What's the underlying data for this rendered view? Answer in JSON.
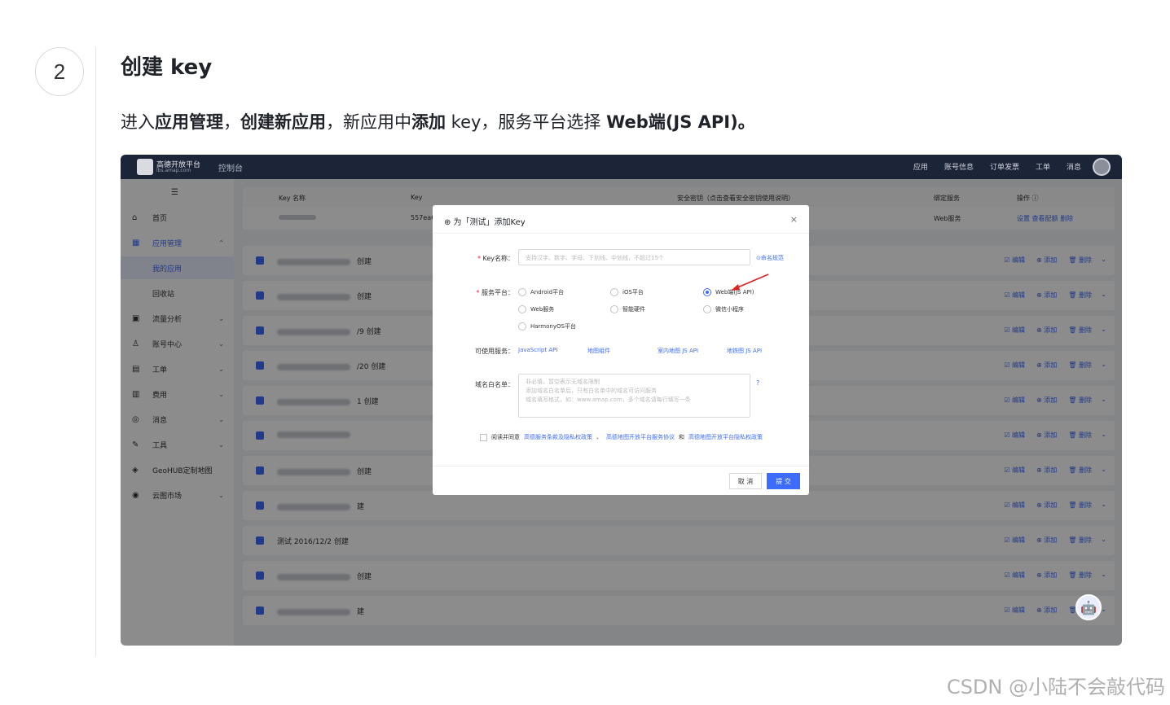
{
  "step": {
    "number": "2",
    "title": "创建 key",
    "desc": {
      "p1": "进入",
      "b1": "应用管理",
      "p2": "，",
      "b2": "创建新应用",
      "p3": "，新应用中",
      "b3": "添加",
      "p4": " key，服务平台选择 ",
      "b4": "Web端(JS API)。"
    }
  },
  "console": {
    "logo_text": "高德开放平台",
    "logo_sub": "lbs.amap.com",
    "title": "控制台",
    "nav": [
      "应用",
      "账号信息",
      "订单发票",
      "工单",
      "消息"
    ],
    "sidebar": [
      {
        "icon": "☰",
        "label": "",
        "chev": ""
      },
      {
        "icon": "⌂",
        "label": "首页",
        "chev": ""
      },
      {
        "icon": "▦",
        "label": "应用管理",
        "chev": "⌃"
      },
      {
        "icon": "",
        "label": "我的应用",
        "chev": ""
      },
      {
        "icon": "",
        "label": "回收站",
        "chev": ""
      },
      {
        "icon": "▣",
        "label": "流量分析",
        "chev": "⌄"
      },
      {
        "icon": "♙",
        "label": "账号中心",
        "chev": "⌄"
      },
      {
        "icon": "▤",
        "label": "工单",
        "chev": "⌄"
      },
      {
        "icon": "▥",
        "label": "费用",
        "chev": "⌄"
      },
      {
        "icon": "◎",
        "label": "消息",
        "chev": "⌄"
      },
      {
        "icon": "✎",
        "label": "工具",
        "chev": "⌄"
      },
      {
        "icon": "◈",
        "label": "GeoHUB定制地图",
        "chev": ""
      },
      {
        "icon": "◉",
        "label": "云图市场",
        "chev": "⌄"
      }
    ],
    "table_head": {
      "key_name": "Key 名称",
      "key": "Key",
      "secret": "安全密钥（点击查看安全密钥使用说明）",
      "service": "绑定服务",
      "ops": "操作 ⓘ"
    },
    "first_row": {
      "key": "557ea6",
      "service": "Web服务",
      "ops": "设置  查看配额  删除"
    },
    "apps": [
      {
        "suffix": "创建"
      },
      {
        "suffix": "创建"
      },
      {
        "suffix": "/9 创建"
      },
      {
        "suffix": "/20 创建"
      },
      {
        "suffix": "1 创建"
      },
      {
        "suffix": ""
      },
      {
        "suffix": "创建"
      },
      {
        "suffix": "建"
      },
      {
        "suffix": "测试  2016/12/2 创建"
      },
      {
        "suffix": "创建"
      },
      {
        "suffix": "建"
      }
    ],
    "card_actions": [
      "☑ 编辑",
      "⊕ 添加",
      "🗑 删除"
    ],
    "card_chev": "⌄"
  },
  "modal": {
    "title": "⊕ 为「测试」添加Key",
    "close": "×",
    "key_name_label": "Key名称：",
    "key_name_placeholder": "支持汉字、数字、字母、下划线、中划线，不超过15个",
    "naming_link": "⊙命名规范",
    "platform_label": "服务平台：",
    "platforms": [
      "Android平台",
      "iOS平台",
      "Web端(JS API)",
      "Web服务",
      "智能硬件",
      "微信小程序",
      "HarmonyOS平台"
    ],
    "available_label": "可使用服务：",
    "available": [
      "JavaScript API",
      "地图组件",
      "室内地图 JS API",
      "地铁图 JS API"
    ],
    "domain_label": "域名白名单：",
    "domain_placeholder": [
      "非必填，暂空表示无域名限制",
      "添加域名白名单后，只有白名单中的域名可访问服务",
      "域名填写格式，如：www.amap.com，多个域名请每行填写一条"
    ],
    "agree_text": "阅读并同意",
    "agree_links": [
      "高德服务条款及隐私权政策",
      "高德地图开放平台服务协议",
      "高德地图开放平台隐私权政策"
    ],
    "agree_sep1": "、",
    "agree_sep2": "和",
    "cancel": "取 消",
    "submit": "提 交"
  },
  "watermark": "CSDN @小陆不会敲代码"
}
